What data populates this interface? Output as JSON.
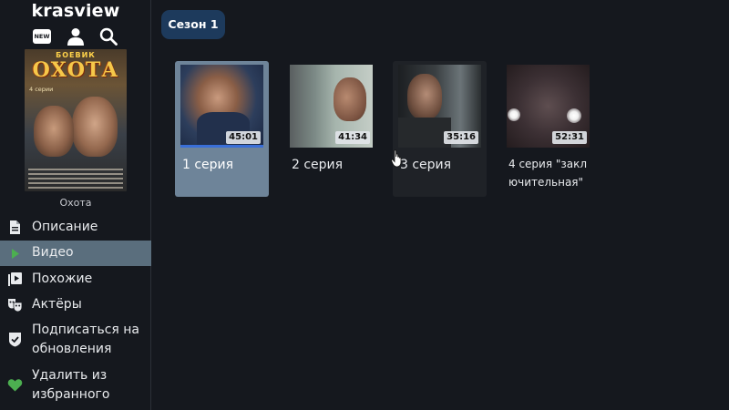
{
  "app": {
    "logo": "krasview"
  },
  "top_icons": {
    "new_label": "NEW"
  },
  "poster": {
    "genre": "БОЕВИК",
    "title": "ОХОТА",
    "episodes_text": "4 серии",
    "caption": "Охота"
  },
  "menu": {
    "items": [
      {
        "label": "Описание",
        "icon": "document-icon"
      },
      {
        "label": "Видео",
        "icon": "play-icon",
        "active": true
      },
      {
        "label": "Похожие",
        "icon": "video-library-icon"
      },
      {
        "label": "Актёры",
        "icon": "theater-masks-icon"
      },
      {
        "label": "Подписаться на обновления",
        "line1": "Подписаться на",
        "line2": "обновления",
        "icon": "shield-check-icon"
      },
      {
        "label": "Удалить из избранного",
        "line1": "Удалить из",
        "line2": "избранного",
        "icon": "heart-icon"
      }
    ]
  },
  "season": {
    "tab_label": "Сезон 1"
  },
  "episodes": [
    {
      "title": "1 серия",
      "duration": "45:01",
      "progress": 1.0
    },
    {
      "title": "2 серия",
      "duration": "41:34"
    },
    {
      "title": "3 серия",
      "duration": "35:16"
    },
    {
      "title": "4 серия \"заключительная\"",
      "line1": "4 серия \"закл",
      "line2": "ючительная\"",
      "duration": "52:31"
    }
  ],
  "colors": {
    "background": "#15181e",
    "active_menu": "#5a6e7d",
    "selected_card": "#6e8499",
    "season_tab": "#1d3a5c",
    "accent_green": "#4caf50",
    "progress": "#3a6fd8"
  }
}
